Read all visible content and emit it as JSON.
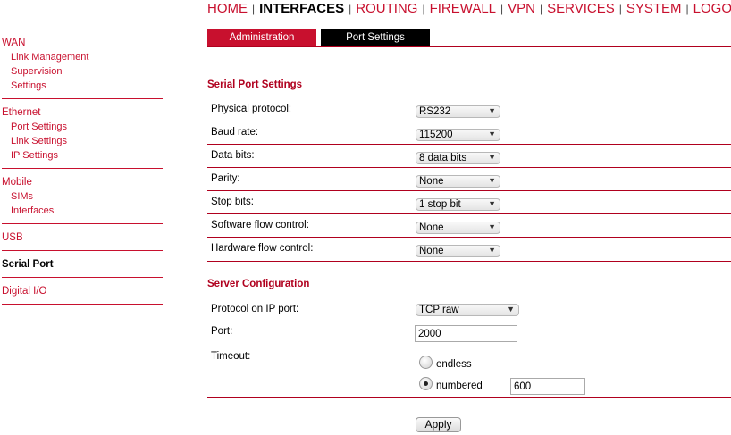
{
  "top_nav": {
    "items": [
      {
        "label": "HOME",
        "active": false
      },
      {
        "label": "INTERFACES",
        "active": true
      },
      {
        "label": "ROUTING",
        "active": false
      },
      {
        "label": "FIREWALL",
        "active": false
      },
      {
        "label": "VPN",
        "active": false
      },
      {
        "label": "SERVICES",
        "active": false
      },
      {
        "label": "SYSTEM",
        "active": false
      },
      {
        "label": "LOGOUT",
        "active": false
      }
    ],
    "separator": "|"
  },
  "sub_tabs": {
    "administration": "Administration",
    "port_settings": "Port Settings"
  },
  "sidebar": {
    "wan": {
      "title": "WAN",
      "items": [
        "Link Management",
        "Supervision",
        "Settings"
      ]
    },
    "ethernet": {
      "title": "Ethernet",
      "items": [
        "Port Settings",
        "Link Settings",
        "IP Settings"
      ]
    },
    "mobile": {
      "title": "Mobile",
      "items": [
        "SIMs",
        "Interfaces"
      ]
    },
    "usb": {
      "title": "USB"
    },
    "serial_port": {
      "title": "Serial Port"
    },
    "digital_io": {
      "title": "Digital I/O"
    }
  },
  "serial_settings": {
    "title": "Serial Port Settings",
    "rows": [
      {
        "label": "Physical protocol:",
        "value": "RS232"
      },
      {
        "label": "Baud rate:",
        "value": "115200"
      },
      {
        "label": "Data bits:",
        "value": "8 data bits"
      },
      {
        "label": "Parity:",
        "value": "None"
      },
      {
        "label": "Stop bits:",
        "value": "1 stop bit"
      },
      {
        "label": "Software flow control:",
        "value": "None"
      },
      {
        "label": "Hardware flow control:",
        "value": "None"
      }
    ]
  },
  "server_config": {
    "title": "Server Configuration",
    "protocol_label": "Protocol on IP port:",
    "protocol_value": "TCP raw",
    "port_label": "Port:",
    "port_value": "2000",
    "timeout_label": "Timeout:",
    "endless_label": "endless",
    "numbered_label": "numbered",
    "timeout_value": "600",
    "selected_timeout": "numbered"
  },
  "apply_label": "Apply",
  "colors": {
    "accent": "#c8102e",
    "active_tab": "#000000"
  }
}
